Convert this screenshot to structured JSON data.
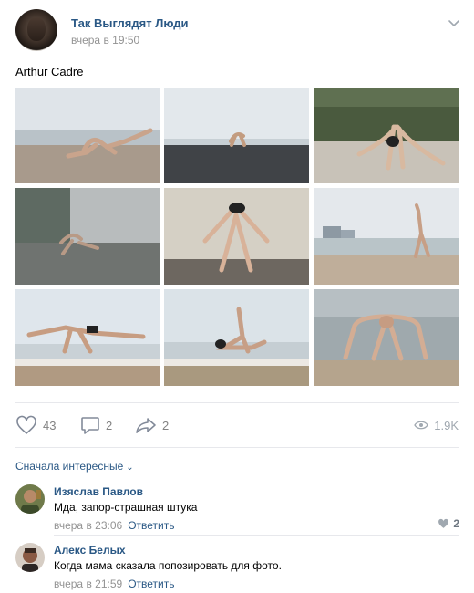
{
  "post": {
    "author": "Так Выглядят Люди",
    "time": "вчера в 19:50",
    "text": "Arthur Cadre"
  },
  "actions": {
    "likes": "43",
    "comments": "2",
    "shares": "2",
    "views": "1.9K"
  },
  "comments_section": {
    "sort_label": "Сначала интересные"
  },
  "comments": [
    {
      "author": "Изяслав Павлов",
      "text": "Мда, запор-страшная штука",
      "time": "вчера в 23:06",
      "reply_label": "Ответить",
      "likes": "2"
    },
    {
      "author": "Алекс Белых",
      "text": "Когда мама сказала попозировать для фото.",
      "time": "вчера в 21:59",
      "reply_label": "Ответить"
    }
  ],
  "colors": {
    "link": "#2a5885",
    "muted": "#939393",
    "icon": "#828a99"
  },
  "icons": [
    "chevron-down-icon",
    "heart-icon",
    "comment-icon",
    "share-icon",
    "eye-icon"
  ]
}
